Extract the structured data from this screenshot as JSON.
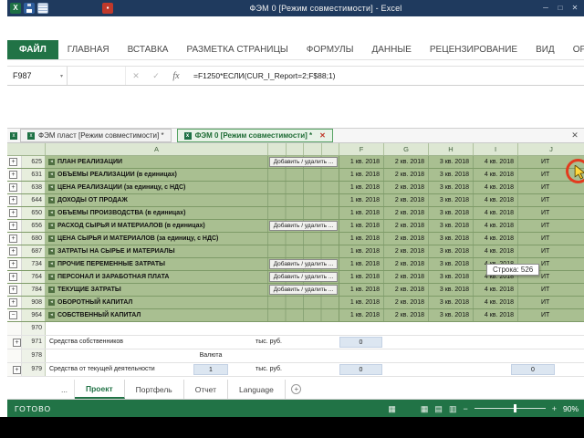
{
  "colors": {
    "titlebar": "#1f3a5e",
    "excel_green": "#217346",
    "row_green": "#a9bf91",
    "grid_line": "#7e9b68",
    "blue_cell": "#dce6f1"
  },
  "titlebar": {
    "title": "ФЭМ 0  [Режим совместимости] - Excel"
  },
  "glyphs": {
    "excel_logo": "X",
    "record": "▪",
    "name_box_arrow": "▾",
    "cancel": "✕",
    "enter": "✓",
    "fx": "fx",
    "doc_mini": "x",
    "doc_close": "✕",
    "minimize": "─",
    "maximize": "□",
    "close": "✕",
    "view_normal": "▦",
    "view_layout": "▤",
    "view_break": "▥",
    "table": "▦",
    "zoom_minus": "−",
    "zoom_plus": "+",
    "ellipsis": "..."
  },
  "ribbon_tabs": [
    {
      "label": "ФАЙЛ",
      "active": true
    },
    {
      "label": "ГЛАВНАЯ"
    },
    {
      "label": "ВСТАВКА"
    },
    {
      "label": "РАЗМЕТКА СТРАНИЦЫ"
    },
    {
      "label": "ФОРМУЛЫ"
    },
    {
      "label": "ДАННЫЕ"
    },
    {
      "label": "РЕЦЕНЗИРОВАНИЕ"
    },
    {
      "label": "ВИД"
    },
    {
      "label": "ОР"
    }
  ],
  "formula_bar": {
    "name_box": "F987",
    "formula": "=F1250*ЕСЛИ(CUR_I_Report=2;F$88;1)"
  },
  "doc_tabs": [
    {
      "label": "ФЭМ пласт  [Режим совместимости] *",
      "active": false
    },
    {
      "label": "ФЭМ 0  [Режим совместимости] *",
      "active": true
    }
  ],
  "grid": {
    "col_letters": [
      "A",
      "F",
      "G",
      "H",
      "I",
      "J"
    ],
    "quarters": [
      "1 кв. 2018",
      "2 кв. 2018",
      "3 кв. 2018",
      "4 кв. 2018"
    ],
    "total_label": "ИТ",
    "add_remove_label": "Добавить / удалить ...",
    "row_marker": "◂",
    "green_rows": [
      {
        "num": "625",
        "label": "ПЛАН РЕАЛИЗАЦИИ",
        "button": true,
        "outline": "+"
      },
      {
        "num": "631",
        "label": "ОБЪЕМЫ РЕАЛИЗАЦИИ (в единицах)",
        "outline": "+"
      },
      {
        "num": "638",
        "label": "ЦЕНА РЕАЛИЗАЦИИ (за единицу, с НДС)",
        "outline": "+"
      },
      {
        "num": "644",
        "label": "ДОХОДЫ ОТ ПРОДАЖ",
        "outline": "+"
      },
      {
        "num": "650",
        "label": "ОБЪЕМЫ ПРОИЗВОДСТВА (в единицах)",
        "outline": "+"
      },
      {
        "num": "656",
        "label": "РАСХОД СЫРЬЯ И МАТЕРИАЛОВ (в единицах)",
        "button": true,
        "outline": "+"
      },
      {
        "num": "680",
        "label": "ЦЕНА СЫРЬЯ И МАТЕРИАЛОВ (за единицу, с НДС)",
        "outline": "+"
      },
      {
        "num": "687",
        "label": "ЗАТРАТЫ НА СЫРЬЕ И МАТЕРИАЛЫ",
        "outline": "+"
      },
      {
        "num": "734",
        "label": "ПРОЧИЕ ПЕРЕМЕННЫЕ ЗАТРАТЫ",
        "button": true,
        "outline": "+"
      },
      {
        "num": "764",
        "label": "ПЕРСОНАЛ И ЗАРАБОТНАЯ ПЛАТА",
        "button": true,
        "outline": "+"
      },
      {
        "num": "784",
        "label": "ТЕКУЩИЕ ЗАТРАТЫ",
        "button": true,
        "outline": "+"
      },
      {
        "num": "908",
        "label": "ОБОРОТНЫЙ КАПИТАЛ",
        "outline": "+"
      },
      {
        "num": "964",
        "label": "СОБСТВЕННЫЙ КАПИТАЛ",
        "outline": "−"
      }
    ],
    "bottom_rows": [
      {
        "num": "970"
      },
      {
        "num": "971",
        "label": "Средства собственников",
        "unit": "тыс. руб.",
        "f": "0",
        "outline": "+"
      },
      {
        "num": "978",
        "c": "Валюта"
      },
      {
        "num": "979",
        "label": "Средства от текущей деятельности",
        "c": "1",
        "c_blue": true,
        "unit": "тыс. руб.",
        "f": "0",
        "j": "0",
        "outline": "+"
      }
    ]
  },
  "tooltip": "Строка: 526",
  "sheet_bar": {
    "tabs": [
      {
        "label": "Проект",
        "active": true
      },
      {
        "label": "Портфель"
      },
      {
        "label": "Отчет"
      },
      {
        "label": "Language"
      }
    ]
  },
  "status_bar": {
    "ready": "ГОТОВО",
    "zoom": "90%"
  }
}
